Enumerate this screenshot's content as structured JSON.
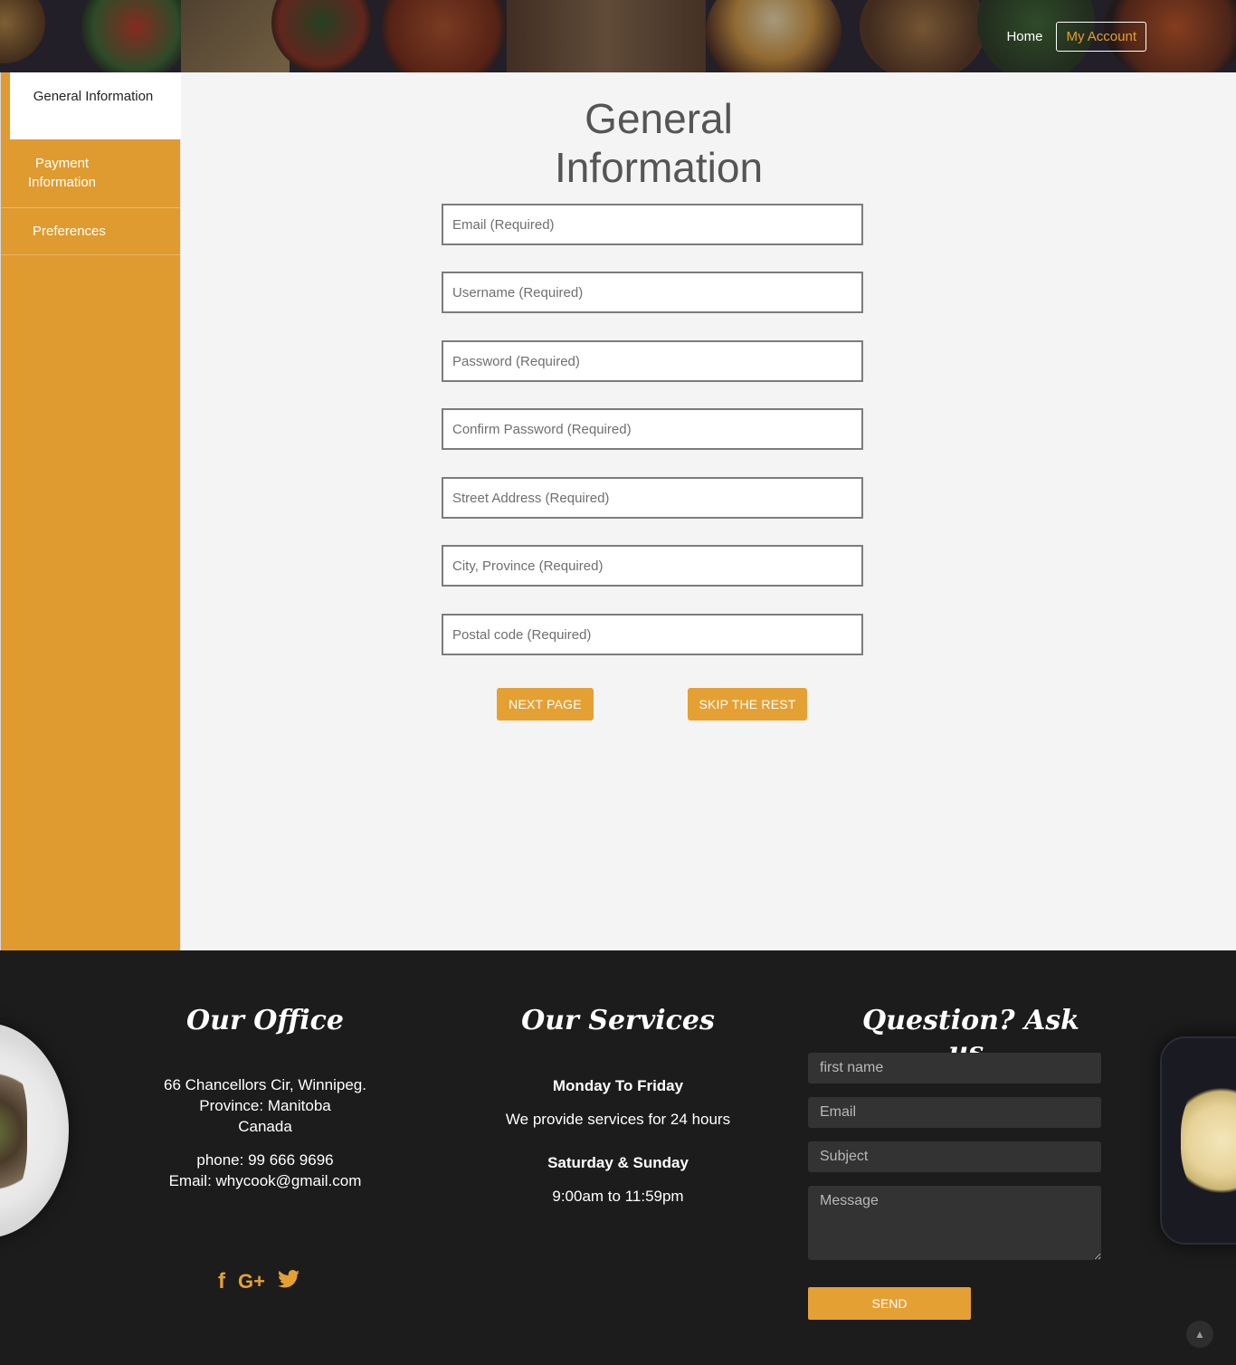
{
  "header": {
    "nav": {
      "home": "Home",
      "my_account": "My Account"
    }
  },
  "sidebar": {
    "items": [
      {
        "label": "General Information",
        "active": true
      },
      {
        "label": "Payment Information",
        "active": false
      },
      {
        "label": "Preferences",
        "active": false
      }
    ]
  },
  "main": {
    "title": "General Information",
    "fields": [
      {
        "placeholder": "Email (Required)",
        "value": ""
      },
      {
        "placeholder": "Username (Required)",
        "value": ""
      },
      {
        "placeholder": "Password (Required)",
        "value": ""
      },
      {
        "placeholder": "Confirm Password (Required)",
        "value": ""
      },
      {
        "placeholder": "Street Address (Required)",
        "value": ""
      },
      {
        "placeholder": "City, Province (Required)",
        "value": ""
      },
      {
        "placeholder": "Postal code (Required)",
        "value": ""
      }
    ],
    "buttons": {
      "next": "Next page",
      "skip": "Skip the rest"
    }
  },
  "footer": {
    "office": {
      "heading": "Our Office",
      "address_line1": "66 Chancellors Cir, Winnipeg.",
      "address_line2": "Province: Manitoba",
      "address_line3": "Canada",
      "phone": "phone: 99 666 9696",
      "email": "Email: whycook@gmail.com",
      "social_icons": [
        "facebook-icon",
        "google-plus-icon",
        "twitter-icon"
      ]
    },
    "services": {
      "heading": "Our Services",
      "weekday_title": "Monday To Friday",
      "weekday_text": "We provide services for 24 hours",
      "weekend_title": "Saturday & Sunday",
      "weekend_text": "9:00am to 11:59pm"
    },
    "contact": {
      "heading": "Question? Ask us.",
      "first_name_placeholder": "first name",
      "email_placeholder": "Email",
      "subject_placeholder": "Subject",
      "message_placeholder": "Message",
      "send_label": "Send"
    }
  },
  "colors": {
    "accent": "#e5a034",
    "sidebar": "#df9b30",
    "footer_bg": "#1c1c1c",
    "main_bg": "#f4f4f4"
  }
}
